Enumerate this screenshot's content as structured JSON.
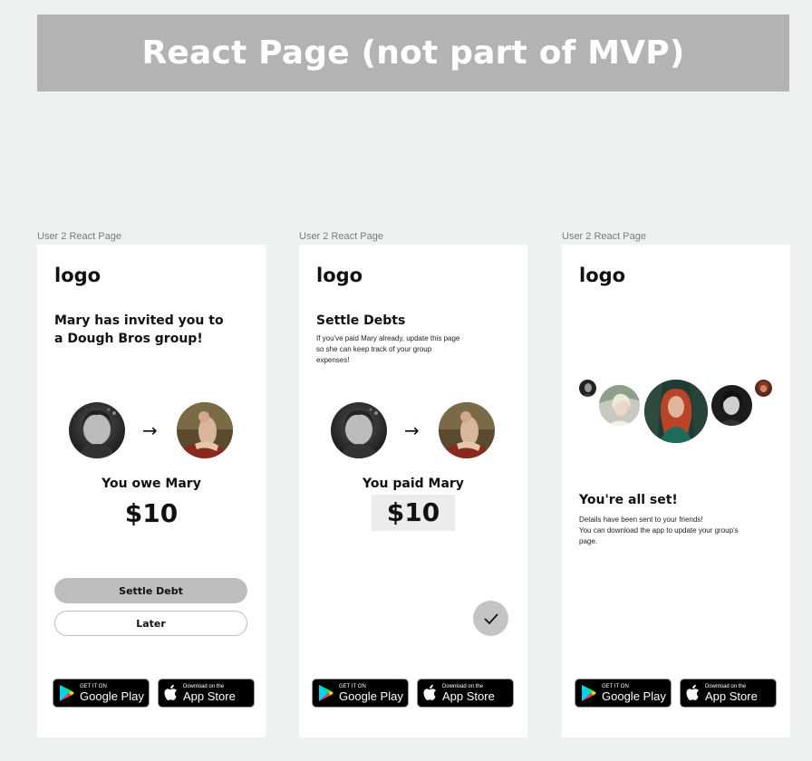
{
  "banner": {
    "title": "React Page (not part of MVP)"
  },
  "colors": {
    "banner_bg": "#b3b3b3",
    "button_grey": "#bdbdbd",
    "canvas_bg": "#eef1f2"
  },
  "screens": [
    {
      "frame_label": "User 2 React Page",
      "logo": "logo",
      "heading": "Mary has invited you to a Dough Bros group!",
      "owe_text": "You owe Mary",
      "amount": "$10",
      "settle_button": "Settle Debt",
      "later_button": "Later"
    },
    {
      "frame_label": "User 2 React Page",
      "logo": "logo",
      "heading": "Settle Debts",
      "subtext": "If you've paid Mary already, update this page so she can keep track of your group expenses!",
      "owe_text": "You paid Mary",
      "amount": "$10"
    },
    {
      "frame_label": "User 2 React Page",
      "logo": "logo",
      "heading": "You're all set!",
      "subtext_line1": "Details have been sent to your friends!",
      "subtext_line2": "You can download the app to update your group's page."
    }
  ],
  "store_badges": {
    "google": {
      "small": "GET IT ON",
      "big": "Google Play",
      "icon": "google-play-icon"
    },
    "apple": {
      "small": "Download on the",
      "big": "App Store",
      "icon": "apple-icon"
    }
  }
}
